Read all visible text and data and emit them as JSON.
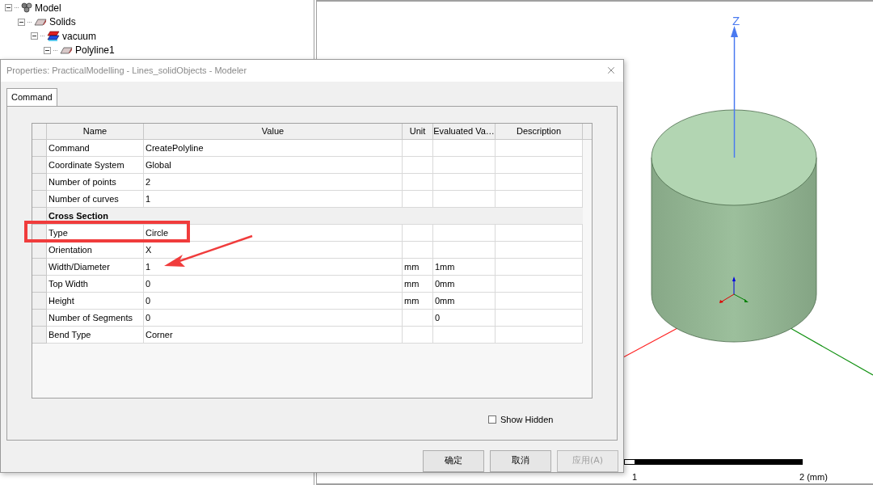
{
  "tree": [
    {
      "label": "Model",
      "kind": "model",
      "expanded": true,
      "children": [
        {
          "label": "Solids",
          "kind": "solid",
          "expanded": true,
          "children": [
            {
              "label": "vacuum",
              "kind": "material",
              "expanded": true,
              "children": [
                {
                  "label": "Polyline1",
                  "kind": "solid",
                  "expanded": true
                }
              ]
            }
          ]
        }
      ]
    }
  ],
  "viewport": {
    "axis_label": "Z",
    "scale_labels": [
      "1",
      "2 (mm)"
    ]
  },
  "dialog": {
    "title": "Properties: PracticalModelling - Lines_solidObjects - Modeler",
    "tabs": [
      {
        "label": "Command",
        "selected": true
      }
    ],
    "table": {
      "columns": [
        "Name",
        "Value",
        "Unit",
        "Evaluated Va…",
        "Description"
      ],
      "rows": [
        {
          "kind": "property",
          "name": "Command",
          "value": "CreatePolyline"
        },
        {
          "kind": "property",
          "name": "Coordinate System",
          "value": "Global"
        },
        {
          "kind": "property",
          "name": "Number of points",
          "value": "2"
        },
        {
          "kind": "property",
          "name": "Number of curves",
          "value": "1"
        },
        {
          "kind": "group",
          "name": "Cross Section"
        },
        {
          "kind": "property",
          "name": "Type",
          "value": "Circle"
        },
        {
          "kind": "property",
          "name": "Orientation",
          "value": "X"
        },
        {
          "kind": "property",
          "name": "Width/Diameter",
          "value": "1",
          "unit": "mm",
          "evaluated": "1mm"
        },
        {
          "kind": "property",
          "name": "Top Width",
          "value": "0",
          "unit": "mm",
          "evaluated": "0mm"
        },
        {
          "kind": "property",
          "name": "Height",
          "value": "0",
          "unit": "mm",
          "evaluated": "0mm"
        },
        {
          "kind": "property",
          "name": "Number of Segments",
          "value": "0",
          "evaluated": "0"
        },
        {
          "kind": "property",
          "name": "Bend Type",
          "value": "Corner"
        }
      ]
    },
    "show_hidden": {
      "label": "Show Hidden",
      "checked": false
    },
    "buttons": [
      {
        "label": "确定",
        "disabled": false
      },
      {
        "label": "取消",
        "disabled": false
      },
      {
        "label": "应用(A)",
        "disabled": true
      }
    ]
  }
}
